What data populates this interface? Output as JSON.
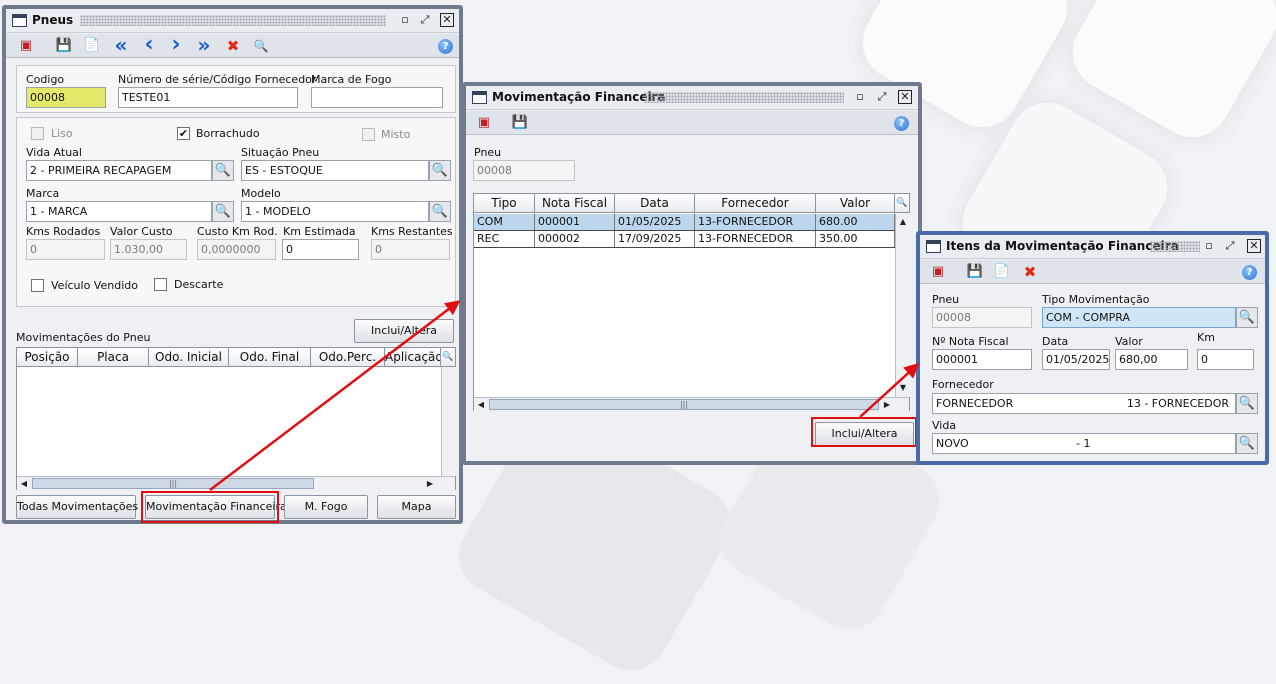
{
  "icons": {
    "window": "window-icon",
    "minimize": "minimize-icon",
    "maximize": "maximize-icon",
    "close": "close-icon",
    "help": "help-icon",
    "exit": "exit-icon",
    "save": "save-icon",
    "new": "new-document-icon",
    "first": "first-icon",
    "previous": "previous-icon",
    "next": "next-icon",
    "last": "last-icon",
    "delete": "delete-icon",
    "search": "search-icon",
    "lookup": "lookup-icon",
    "annotation_arrow": "red-arrow"
  },
  "colors": {
    "highlight": "#e01010",
    "selected_row": "#bcd6ee",
    "yellow_field": "#e4e96a"
  },
  "pneus": {
    "title": "Pneus",
    "codigo_label": "Codigo",
    "codigo": "00008",
    "serie_label": "Número de série/Código Fornecedor",
    "serie": "TESTE01",
    "marca_fogo_label": "Marca de Fogo",
    "marca_fogo": "",
    "liso_label": "Liso",
    "liso_checked": false,
    "borrachudo_label": "Borrachudo",
    "borrachudo_checked": true,
    "misto_label": "Misto",
    "misto_checked": false,
    "vida_label": "Vida Atual",
    "vida": "2  - PRIMEIRA RECAPAGEM",
    "situacao_label": "Situação Pneu",
    "situacao": "ES - ESTOQUE",
    "marca_label": "Marca",
    "marca": "1          - MARCA",
    "modelo_label": "Modelo",
    "modelo": "1          - MODELO",
    "kms_rodados_label": "Kms Rodados",
    "kms_rodados": "0",
    "valor_custo_label": "Valor Custo",
    "valor_custo": "1.030,00",
    "custo_km_label": "Custo Km Rod.",
    "custo_km": "0,0000000",
    "km_estimada_label": "Km Estimada",
    "km_estimada": "0",
    "kms_restantes_label": "Kms Restantes",
    "kms_restantes": "0",
    "veiculo_vendido_label": "Veículo Vendido",
    "veiculo_vendido_checked": false,
    "descarte_label": "Descarte",
    "descarte_checked": false,
    "movimentacoes_label": "Movimentações do Pneu",
    "inclui_altera_button": "Inclui/Altera",
    "mov_columns": [
      "Posição",
      "Placa",
      "Odo. Inicial",
      "Odo. Final",
      "Odo.Perc.",
      "Aplicação"
    ],
    "todas_button": "Todas Movimentações",
    "mov_financeira_button": "Movimentação Financeira",
    "m_fogo_button": "M. Fogo",
    "mapa_button": "Mapa"
  },
  "mov_fin": {
    "title": "Movimentação Financeira",
    "pneu_label": "Pneu",
    "pneu": "00008",
    "columns": [
      "Tipo",
      "Nota Fiscal",
      "Data",
      "Fornecedor",
      "Valor"
    ],
    "rows": [
      {
        "tipo": "COM",
        "nota": "000001",
        "data": "01/05/2025",
        "fornecedor": "13-FORNECEDOR",
        "valor": "680.00"
      },
      {
        "tipo": "REC",
        "nota": "000002",
        "data": "17/09/2025",
        "fornecedor": "13-FORNECEDOR",
        "valor": "350.00"
      }
    ],
    "inclui_altera_button": "Inclui/Altera"
  },
  "itens": {
    "title": "Itens da Movimentação Financeira",
    "pneu_label": "Pneu",
    "pneu": "00008",
    "tipo_label": "Tipo Movimentação",
    "tipo": "COM - COMPRA",
    "nota_label": "Nº Nota Fiscal",
    "nota": "000001",
    "data_label": "Data",
    "data": "01/05/2025",
    "valor_label": "Valor",
    "valor": "680,00",
    "km_label": "Km",
    "km": "0",
    "fornecedor_label": "Fornecedor",
    "fornecedor_name": "FORNECEDOR",
    "fornecedor_code": "13 - FORNECEDOR",
    "vida_label": "Vida",
    "vida_name": "NOVO",
    "vida_code": "- 1"
  },
  "glyphs": {
    "min": "▫",
    "max": "⤢",
    "close": "✕",
    "check": "✔",
    "search": "🔍",
    "exit": "▣",
    "save": "💾",
    "doc": "📄",
    "first": "«",
    "prev": "‹",
    "next": "›",
    "last": "»",
    "delete": "✖",
    "help": "?",
    "up": "▲",
    "down": "▼",
    "left": "◀",
    "right": "▶",
    "grip": "|||"
  }
}
